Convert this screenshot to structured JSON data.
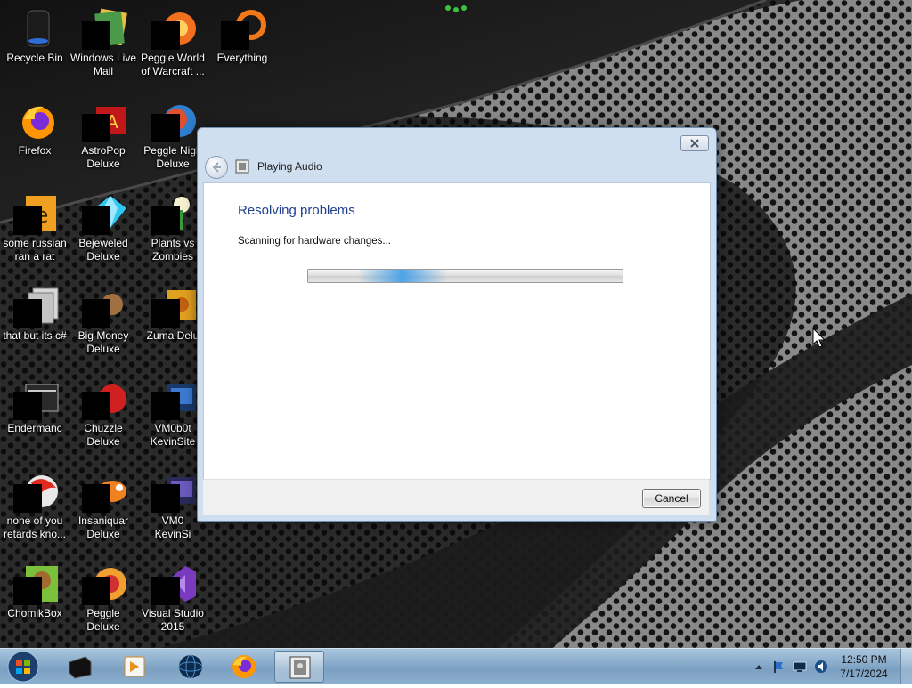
{
  "desktop": {
    "icons": [
      {
        "label": "Recycle Bin",
        "icon": "recycle-bin-icon"
      },
      {
        "label": "Windows Live\nMail",
        "icon": "mail-icon"
      },
      {
        "label": "Peggle World\nof Warcraft ...",
        "icon": "peggle-wow-icon"
      },
      {
        "label": "Everything",
        "icon": "everything-icon"
      },
      {
        "label": "Firefox",
        "icon": "firefox-icon"
      },
      {
        "label": "AstroPop\nDeluxe",
        "icon": "astropop-icon"
      },
      {
        "label": "Peggle Nigh\nDeluxe",
        "icon": "peggle-nights-icon"
      },
      {
        "label": "some russian\nran a rat",
        "icon": "file-icon"
      },
      {
        "label": "Bejeweled\nDeluxe",
        "icon": "bejeweled-icon"
      },
      {
        "label": "Plants vs\nZombies",
        "icon": "plants-vs-zombies-icon"
      },
      {
        "label": "that but its c#",
        "icon": "file-icon"
      },
      {
        "label": "Big Money\nDeluxe",
        "icon": "big-money-icon"
      },
      {
        "label": "Zuma Delu",
        "icon": "zuma-icon"
      },
      {
        "label": "Endermanc",
        "icon": "window-icon"
      },
      {
        "label": "Chuzzle\nDeluxe",
        "icon": "chuzzle-icon"
      },
      {
        "label": "VM0b0t\nKevinSite",
        "icon": "vm-icon"
      },
      {
        "label": "none of you\nretards kno...",
        "icon": "file-icon"
      },
      {
        "label": "Insaniquar\nDeluxe",
        "icon": "insaniquarium-icon"
      },
      {
        "label": "VM0\nKevinSi",
        "icon": "vm-icon"
      },
      {
        "label": "ChomikBox",
        "icon": "chomikbox-icon"
      },
      {
        "label": "Peggle Deluxe",
        "icon": "peggle-icon"
      },
      {
        "label": "Visual Studio\n2015",
        "icon": "visual-studio-icon"
      }
    ]
  },
  "dialog": {
    "title": "Playing Audio",
    "heading": "Resolving problems",
    "status": "Scanning for hardware changes...",
    "progress_fraction": 0.3,
    "cancel_label": "Cancel"
  },
  "taskbar": {
    "pinned": [
      {
        "name": "black-box-app-icon"
      },
      {
        "name": "media-player-icon"
      },
      {
        "name": "globe-icon"
      },
      {
        "name": "firefox-icon"
      },
      {
        "name": "troubleshooter-icon",
        "active": true
      }
    ],
    "tray": {
      "time": "12:50 PM",
      "date": "7/17/2024"
    }
  },
  "colors": {
    "dialog_heading": "#1f3f8f",
    "taskbar": "#86a9c9",
    "progress_glow": "#46a0e6"
  }
}
